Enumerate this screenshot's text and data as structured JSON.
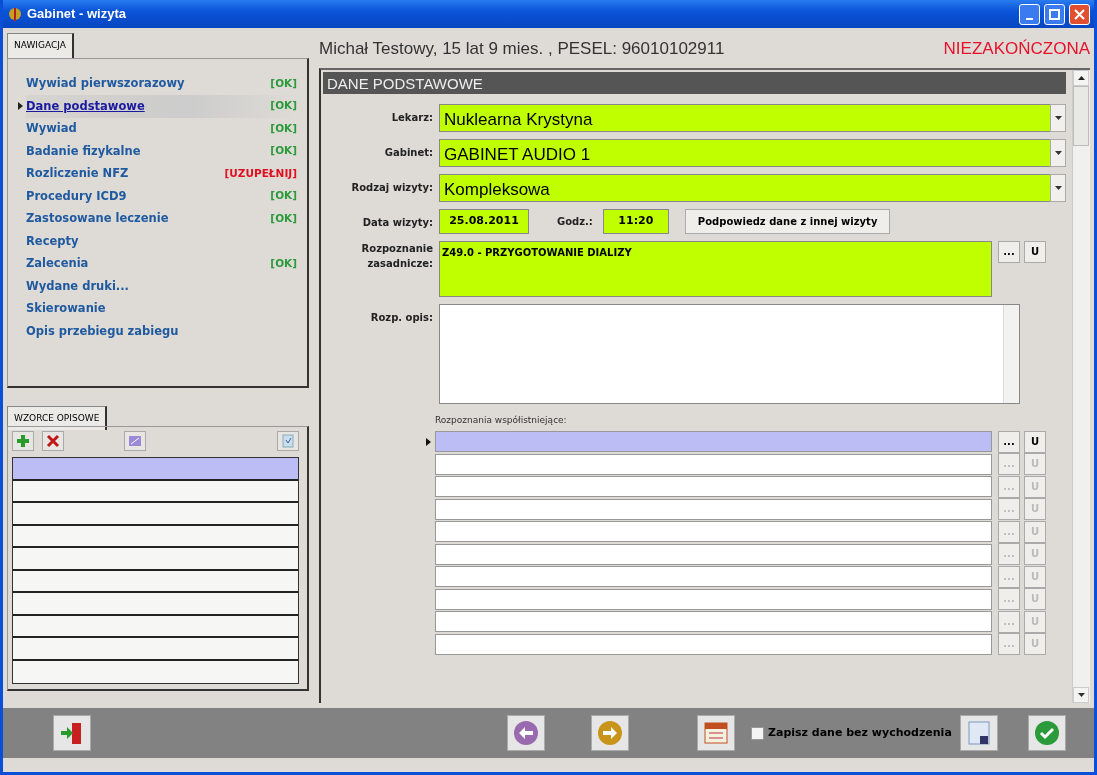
{
  "window": {
    "title": "Gabinet - wizyta"
  },
  "navigation": {
    "tab": "NAWIGACJA",
    "items": [
      {
        "label": "Wywiad pierwszorazowy",
        "status": "[OK]",
        "kind": "ok",
        "selected": false
      },
      {
        "label": "Dane podstawowe",
        "status": "[OK]",
        "kind": "ok",
        "selected": true
      },
      {
        "label": "Wywiad",
        "status": "[OK]",
        "kind": "ok",
        "selected": false
      },
      {
        "label": "Badanie fizykalne",
        "status": "[OK]",
        "kind": "ok",
        "selected": false
      },
      {
        "label": "Rozliczenie NFZ",
        "status": "[UZUPEŁNIJ]",
        "kind": "missing",
        "selected": false
      },
      {
        "label": "Procedury ICD9",
        "status": "[OK]",
        "kind": "ok",
        "selected": false
      },
      {
        "label": "Zastosowane leczenie",
        "status": "[OK]",
        "kind": "ok",
        "selected": false
      },
      {
        "label": "Recepty",
        "selected": false
      },
      {
        "label": "Zalecenia",
        "status": "[OK]",
        "kind": "ok",
        "selected": false
      },
      {
        "label": "Wydane druki...",
        "selected": false
      },
      {
        "label": "Skierowanie",
        "selected": false
      },
      {
        "label": "Opis przebiegu zabiegu",
        "selected": false
      }
    ]
  },
  "templates": {
    "tab": "WZORCE OPISOWE",
    "rows": [
      {
        "selected": true
      },
      {
        "selected": false
      },
      {
        "selected": false
      },
      {
        "selected": false
      },
      {
        "selected": false
      },
      {
        "selected": false
      },
      {
        "selected": false
      },
      {
        "selected": false
      },
      {
        "selected": false
      },
      {
        "selected": false
      }
    ]
  },
  "patient": {
    "summary": "Michał Testowy, 15 lat 9 mies. , PESEL: 96010102911",
    "visit_status": "NIEZAKOŃCZONA"
  },
  "form": {
    "section_title": "DANE PODSTAWOWE",
    "dropdowns": [
      {
        "label": "Lekarz:",
        "value": "Nuklearna Krystyna"
      },
      {
        "label": "Gabinet:",
        "value": "GABINET AUDIO 1"
      },
      {
        "label": "Rodzaj wizyty:",
        "value": "Kompleksowa"
      }
    ],
    "date": {
      "label": "Data wizyty:",
      "value": "25.08.2011"
    },
    "time": {
      "label": "Godz.:",
      "value": "11:20"
    },
    "hint_button": "Podpowiedz dane z innej wizyty",
    "main_diagnosis": {
      "label": "Rozpoznanie zasadnicze:",
      "value": "Z49.0 - PRZYGOTOWANIE DIALIZY",
      "pick": "...",
      "clear": "U"
    },
    "description": {
      "label": "Rozp. opis:"
    },
    "coexisting": {
      "label": "Rozpoznania współistniejące:",
      "rows": [
        {
          "selected": true,
          "disabled": false,
          "pick": "...",
          "clear": "U"
        },
        {
          "selected": false,
          "disabled": true,
          "pick": "...",
          "clear": "U"
        },
        {
          "selected": false,
          "disabled": true,
          "pick": "...",
          "clear": "U"
        },
        {
          "selected": false,
          "disabled": true,
          "pick": "...",
          "clear": "U"
        },
        {
          "selected": false,
          "disabled": true,
          "pick": "...",
          "clear": "U"
        },
        {
          "selected": false,
          "disabled": true,
          "pick": "...",
          "clear": "U"
        },
        {
          "selected": false,
          "disabled": true,
          "pick": "...",
          "clear": "U"
        },
        {
          "selected": false,
          "disabled": true,
          "pick": "...",
          "clear": "U"
        },
        {
          "selected": false,
          "disabled": true,
          "pick": "...",
          "clear": "U"
        },
        {
          "selected": false,
          "disabled": true,
          "pick": "...",
          "clear": "U"
        }
      ]
    }
  },
  "footer": {
    "save_without_exit": {
      "label": "Zapisz dane bez wychodzenia",
      "checked": false
    }
  }
}
